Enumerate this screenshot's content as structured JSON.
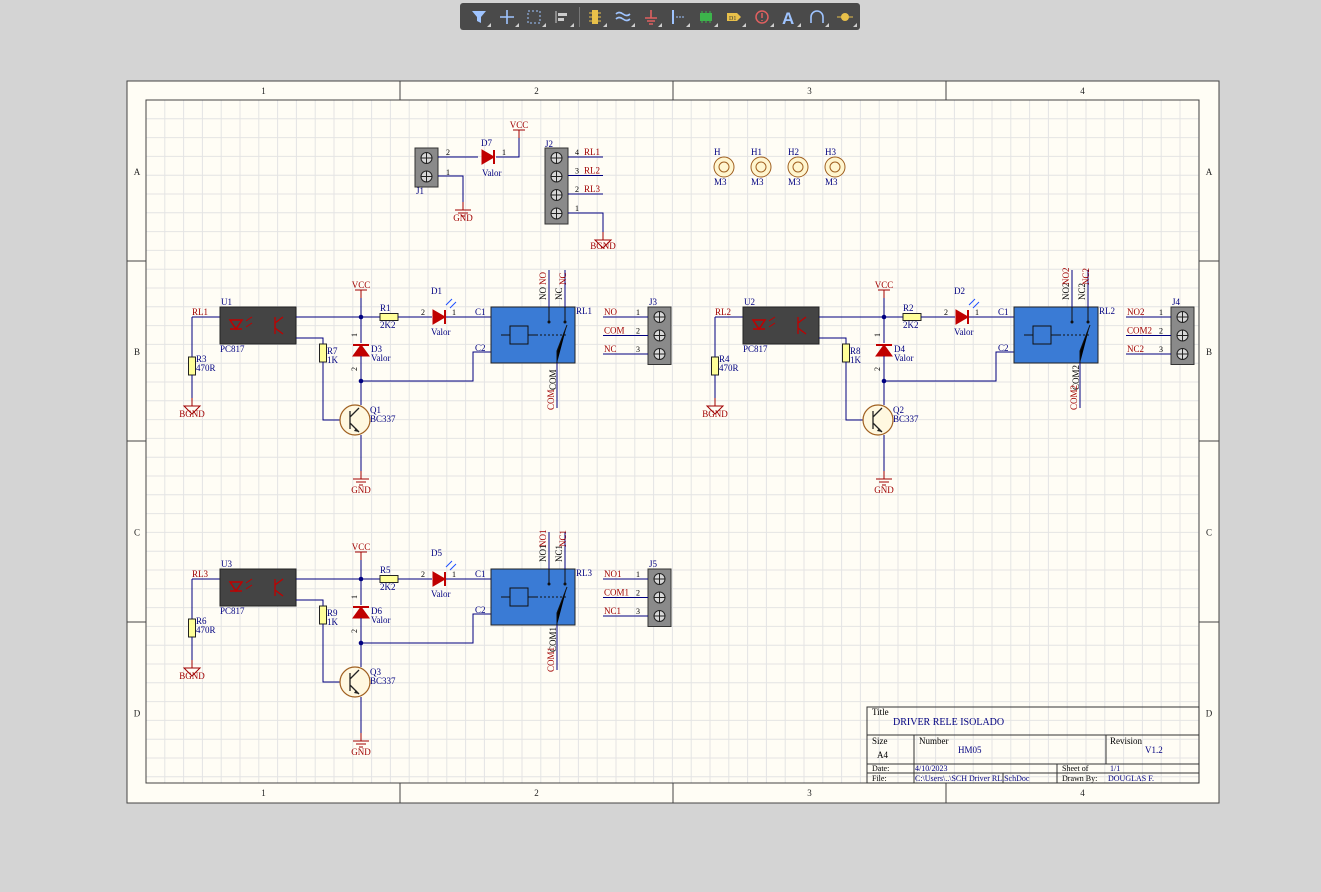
{
  "toolbar": {
    "tools": [
      "filter-icon",
      "cross-probe-icon",
      "select-area-icon",
      "align-icon",
      "place-part-icon",
      "bus-icon",
      "power-port-icon",
      "place-bus-entry-icon",
      "place-component-icon",
      "place-port-icon",
      "place-directive-icon",
      "place-text-icon",
      "place-arc-icon",
      "place-junction-icon"
    ]
  },
  "sheet": {
    "columns": [
      "1",
      "2",
      "3",
      "4"
    ],
    "rows": [
      "A",
      "B",
      "C",
      "D"
    ],
    "title_block": {
      "title_label": "Title",
      "title": "DRIVER RELE ISOLADO",
      "size_label": "Size",
      "size": "A4",
      "number_label": "Number",
      "number": "HM05",
      "revision_label": "Revision",
      "revision": "V1.2",
      "date_label": "Date:",
      "date": "4/10/2023",
      "sheet_label": "Sheet   of",
      "sheet": "1/1",
      "file_label": "File:",
      "file": "C:\\Users\\..\\SCH Driver RL.SchDoc",
      "drawn_label": "Drawn By:",
      "drawn": "DOUGLAS F."
    }
  },
  "power": {
    "j1": "J1",
    "d7": "D7",
    "d7_val": "Valor",
    "vcc": "VCC",
    "gnd": "GND",
    "bgnd": "BGND",
    "j2": "J2",
    "pins": [
      "1",
      "2",
      "1",
      "4",
      "3",
      "2",
      "1"
    ],
    "nets": [
      "RL1",
      "RL2",
      "RL3"
    ]
  },
  "holes": [
    {
      "ref": "H",
      "val": "M3"
    },
    {
      "ref": "H1",
      "val": "M3"
    },
    {
      "ref": "H2",
      "val": "M3"
    },
    {
      "ref": "H3",
      "val": "M3"
    }
  ],
  "channels": [
    {
      "net": "RL1",
      "u": "U1",
      "u_val": "PC817",
      "r_in": "R3",
      "r_in_val": "470R",
      "r_base": "R7",
      "r_base_val": "1K",
      "d": "D3",
      "d_val": "Valor",
      "q": "Q1",
      "q_val": "BC337",
      "r_led": "R1",
      "r_led_val": "2K2",
      "led": "D1",
      "led_val": "Valor",
      "relay": "RL1",
      "c1": "C1",
      "c2": "C2",
      "no": "NO",
      "nc": "NC",
      "com": "COM",
      "j": "J3",
      "pins": [
        "1",
        "2",
        "3",
        "2",
        "1",
        "1",
        "2"
      ],
      "vcc": "VCC",
      "gnd": "GND",
      "bgnd": "BGND"
    },
    {
      "net": "RL2",
      "u": "U2",
      "u_val": "PC817",
      "r_in": "R4",
      "r_in_val": "470R",
      "r_base": "R8",
      "r_base_val": "1K",
      "d": "D4",
      "d_val": "Valor",
      "q": "Q2",
      "q_val": "BC337",
      "r_led": "R2",
      "r_led_val": "2K2",
      "led": "D2",
      "led_val": "Valor",
      "relay": "RL2",
      "c1": "C1",
      "c2": "C2",
      "no": "NO2",
      "nc": "NC2",
      "com": "COM2",
      "j": "J4",
      "pins": [
        "1",
        "2",
        "3",
        "2",
        "1",
        "1",
        "2"
      ],
      "vcc": "VCC",
      "gnd": "GND",
      "bgnd": "BGND"
    },
    {
      "net": "RL3",
      "u": "U3",
      "u_val": "PC817",
      "r_in": "R6",
      "r_in_val": "470R",
      "r_base": "R9",
      "r_base_val": "1K",
      "d": "D6",
      "d_val": "Valor",
      "q": "Q3",
      "q_val": "BC337",
      "r_led": "R5",
      "r_led_val": "2K2",
      "led": "D5",
      "led_val": "Valor",
      "relay": "RL3",
      "c1": "C1",
      "c2": "C2",
      "no": "NO1",
      "nc": "NC1",
      "com": "COM1",
      "j": "J5",
      "pins": [
        "1",
        "2",
        "3",
        "2",
        "1",
        "1",
        "2"
      ],
      "vcc": "VCC",
      "gnd": "GND",
      "bgnd": "BGND"
    }
  ],
  "colors": {
    "paper": "#fffdf5",
    "grid": "#e4e4e4",
    "wire": "#000080",
    "label_red": "#a00000",
    "designator": "#000080",
    "relay_blue": "#3a7bd5",
    "optocoupler": "#444444",
    "connector": "#8a8a8a",
    "resistor": "#ffff99",
    "diode": "#c00000"
  }
}
